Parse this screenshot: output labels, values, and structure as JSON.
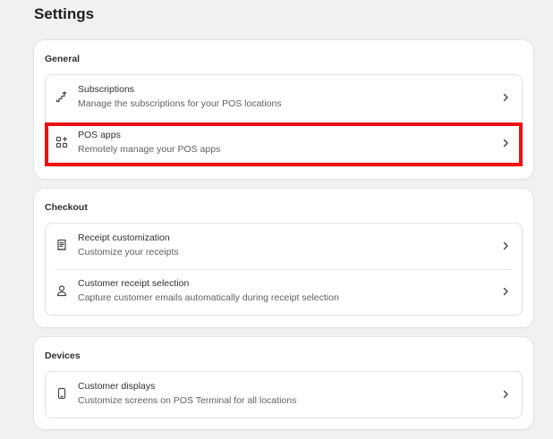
{
  "page": {
    "title": "Settings"
  },
  "sections": [
    {
      "title": "General",
      "rows": [
        {
          "title": "Subscriptions",
          "subtitle": "Manage the subscriptions for your POS locations",
          "icon": "subscriptions-icon"
        },
        {
          "title": "POS apps",
          "subtitle": "Remotely manage your POS apps",
          "icon": "apps-icon"
        }
      ]
    },
    {
      "title": "Checkout",
      "rows": [
        {
          "title": "Receipt customization",
          "subtitle": "Customize your receipts",
          "icon": "receipt-icon"
        },
        {
          "title": "Customer receipt selection",
          "subtitle": "Capture customer emails automatically during receipt selection",
          "icon": "person-icon"
        }
      ]
    },
    {
      "title": "Devices",
      "rows": [
        {
          "title": "Customer displays",
          "subtitle": "Customize screens on POS Terminal for all locations",
          "icon": "mobile-device-icon"
        }
      ]
    }
  ],
  "colors": {
    "highlight": "#ee1111",
    "background": "#f1f1f1",
    "card": "#ffffff"
  },
  "icons": {
    "chevron": "chevron-right-icon"
  }
}
